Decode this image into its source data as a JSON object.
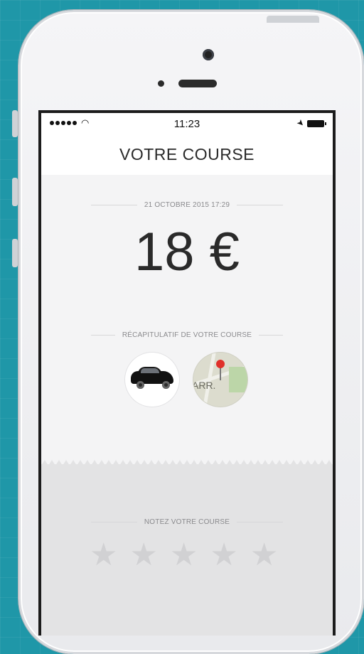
{
  "status_bar": {
    "time": "11:23"
  },
  "nav": {
    "title": "VOTRE COURSE"
  },
  "ride": {
    "date": "21 OCTOBRE 2015 17:29",
    "price": "18 €"
  },
  "summary": {
    "label": "RÉCAPITULATIF DE VOTRE COURSE",
    "map_label": "ARR."
  },
  "rating": {
    "label": "NOTEZ VOTRE COURSE",
    "stars": 5,
    "value": 0
  },
  "colors": {
    "background": "#1f97a8",
    "star_empty": "#d1d1d3",
    "pin": "#e0302b"
  }
}
